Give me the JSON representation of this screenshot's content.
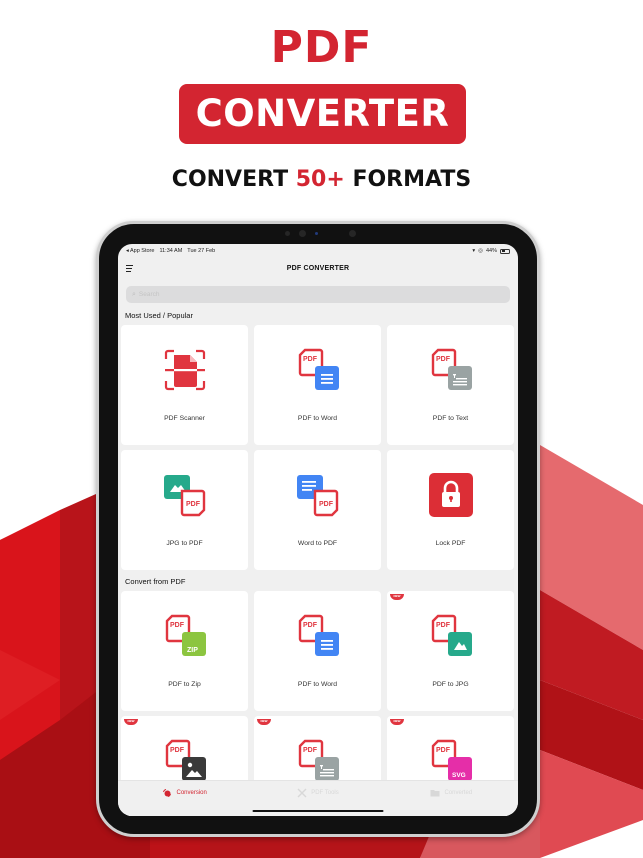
{
  "promo": {
    "title": "PDF",
    "banner": "CONVERTER",
    "subtitle_pre": "CONVERT ",
    "subtitle_highlight": "50+",
    "subtitle_post": " FORMATS",
    "accent_color": "#d32531"
  },
  "status_bar": {
    "back_app": "◂ App Store",
    "time": "11:34 AM",
    "date": "Tue 27 Feb",
    "battery": "44%"
  },
  "nav": {
    "title": "PDF CONVERTER",
    "menu_icon": "hamburger-menu-icon"
  },
  "search": {
    "placeholder": "Search",
    "value": ""
  },
  "sections": [
    {
      "title": "Most Used / Popular",
      "items": [
        {
          "label": "PDF Scanner",
          "icon": "pdf-scanner-icon",
          "new": false
        },
        {
          "label": "PDF to Word",
          "icon": "pdf-to-word-icon",
          "new": false
        },
        {
          "label": "PDF to Text",
          "icon": "pdf-to-text-icon",
          "new": false
        },
        {
          "label": "JPG to PDF",
          "icon": "jpg-to-pdf-icon",
          "new": false
        },
        {
          "label": "Word to PDF",
          "icon": "word-to-pdf-icon",
          "new": false
        },
        {
          "label": "Lock PDF",
          "icon": "lock-icon",
          "new": false
        }
      ]
    },
    {
      "title": "Convert from PDF",
      "items": [
        {
          "label": "PDF to Zip",
          "icon": "pdf-to-zip-icon",
          "new": false
        },
        {
          "label": "PDF to Word",
          "icon": "pdf-to-word-icon",
          "new": false
        },
        {
          "label": "PDF to JPG",
          "icon": "pdf-to-jpg-icon",
          "new": true
        },
        {
          "label": "",
          "icon": "pdf-to-image-icon",
          "new": true
        },
        {
          "label": "",
          "icon": "pdf-to-text-icon",
          "new": true
        },
        {
          "label": "",
          "icon": "pdf-to-svg-icon",
          "new": true
        }
      ]
    }
  ],
  "badge_new": "NEW",
  "tabs": [
    {
      "label": "Conversion",
      "icon": "conversion-icon",
      "active": true
    },
    {
      "label": "PDF Tools",
      "icon": "tools-icon",
      "active": false
    },
    {
      "label": "Converted",
      "icon": "folder-icon",
      "active": false
    }
  ],
  "colors": {
    "pdf_red": "#e0353f",
    "word_blue": "#4285f4",
    "text_gray": "#9aa3a3",
    "jpg_teal": "#26a98b",
    "zip_green": "#8cc540",
    "image_dark": "#3a3a3a",
    "svg_pink": "#e52ea8"
  }
}
